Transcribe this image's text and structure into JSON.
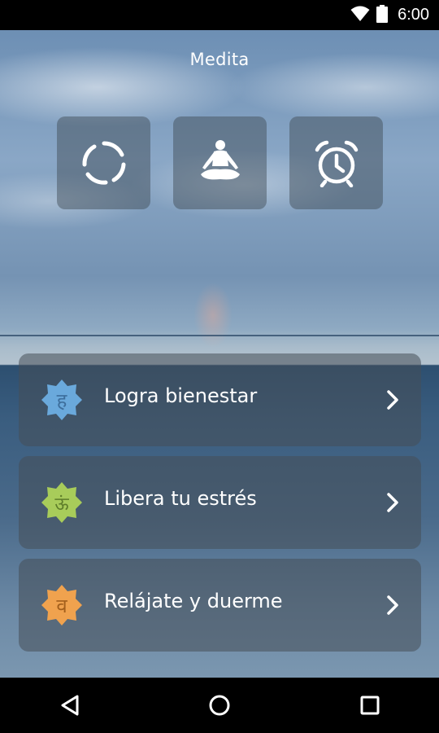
{
  "status_bar": {
    "time": "6:00",
    "icons": [
      "wifi-icon",
      "battery-icon"
    ]
  },
  "header": {
    "title": "Medita"
  },
  "top_buttons": [
    {
      "icon": "timer-ring-icon"
    },
    {
      "icon": "meditation-person-icon"
    },
    {
      "icon": "alarm-clock-icon"
    }
  ],
  "menu": {
    "items": [
      {
        "label": "Logra bienestar",
        "chakra_symbol": "ह",
        "chakra_color": "#6aa9dc"
      },
      {
        "label": "Libera tu estrés",
        "chakra_symbol": "ऊं",
        "chakra_color": "#a8cc5a"
      },
      {
        "label": "Relájate y duerme",
        "chakra_symbol": "व",
        "chakra_color": "#f0a24e"
      }
    ]
  },
  "nav_bar": {
    "buttons": [
      "back-icon",
      "home-icon",
      "recents-icon"
    ]
  },
  "colors": {
    "status_bar": "#000000",
    "nav_bar": "#000000",
    "card_bg": "rgba(70,78,88,0.55)",
    "text": "#ffffff"
  }
}
